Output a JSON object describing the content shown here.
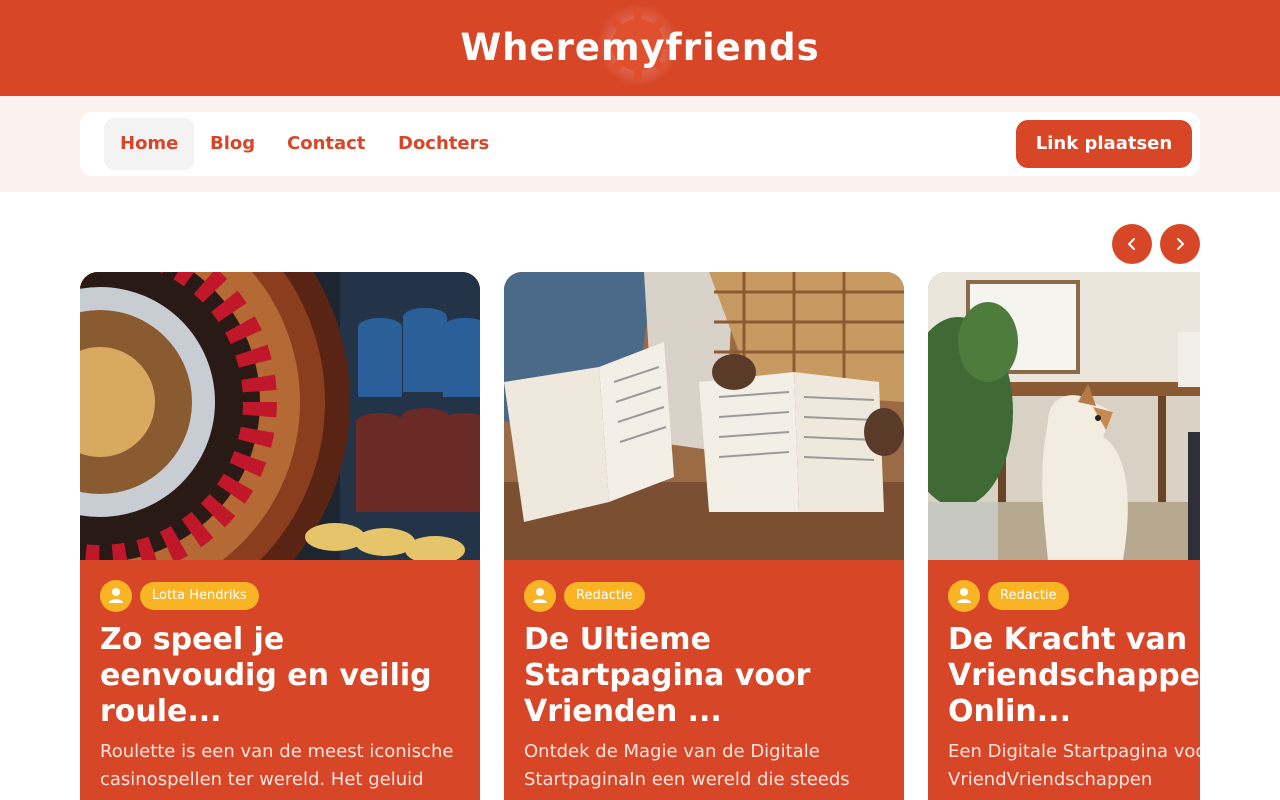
{
  "site": {
    "title": "Wheremyfriends"
  },
  "nav": {
    "items": [
      {
        "label": "Home",
        "active": true
      },
      {
        "label": "Blog",
        "active": false
      },
      {
        "label": "Contact",
        "active": false
      },
      {
        "label": "Dochters",
        "active": false
      }
    ],
    "cta_label": "Link plaatsen"
  },
  "carousel": {
    "prev_icon": "chevron-left-icon",
    "next_icon": "chevron-right-icon",
    "cards": [
      {
        "image": "roulette-wheel-and-casino-chips-photo",
        "author": "Lotta Hendriks",
        "title": "Zo speel je eenvoudig en veilig roule...",
        "excerpt": "Roulette is een van de meest iconische casinospellen ter wereld. Het geluid"
      },
      {
        "image": "people-reading-open-books-photo",
        "author": "Redactie",
        "title": "De Ultieme Startpagina voor Vrienden ...",
        "excerpt": "Ontdek de Magie van de Digitale StartpaginaIn een wereld die steeds"
      },
      {
        "image": "dog-in-cafe-photo",
        "author": "Redactie",
        "title": "De Kracht van Vriendschappen Onlin...",
        "excerpt": "Een Digitale Startpagina voor Moderne VriendVriendschappen"
      }
    ]
  },
  "colors": {
    "brand": "#d84628",
    "accent": "#f8b425",
    "nav_bg": "#fbf1ee"
  }
}
